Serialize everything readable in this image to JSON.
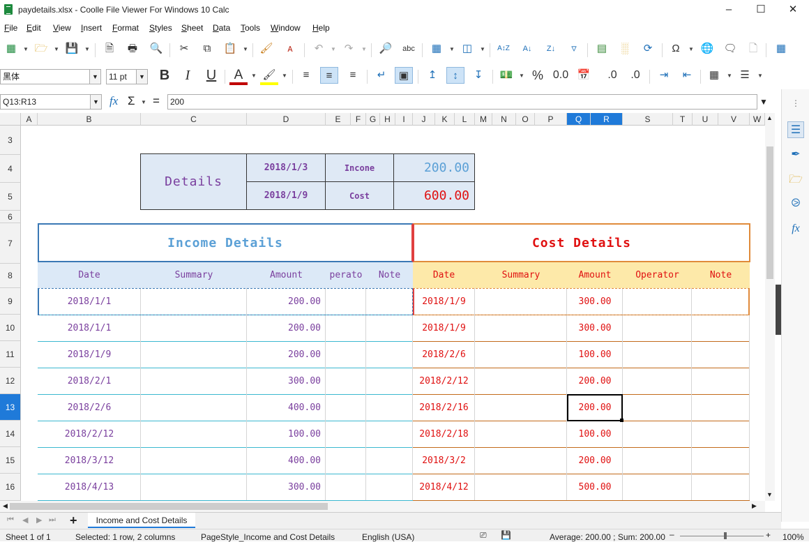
{
  "window": {
    "title": "paydetails.xlsx - Coolle File Viewer For Windows 10 Calc"
  },
  "menu": [
    "File",
    "Edit",
    "View",
    "Insert",
    "Format",
    "Styles",
    "Sheet",
    "Data",
    "Tools",
    "Window",
    "Help"
  ],
  "format_bar": {
    "font_name": "黑体",
    "font_size": "11 pt"
  },
  "formula_bar": {
    "name_box": "Q13:R13",
    "fx": "fx",
    "sigma": "Σ",
    "equals": "=",
    "value": "200"
  },
  "columns": [
    "A",
    "B",
    "C",
    "D",
    "E",
    "F",
    "G",
    "H",
    "I",
    "J",
    "K",
    "L",
    "M",
    "N",
    "O",
    "P",
    "Q",
    "R",
    "S",
    "T",
    "U",
    "V",
    "W"
  ],
  "rows": [
    "3",
    "4",
    "5",
    "6",
    "7",
    "8",
    "9",
    "10",
    "11",
    "12",
    "13",
    "14",
    "15",
    "16"
  ],
  "summary": {
    "label": "Details",
    "date1": "2018/1/3",
    "type1": "Incone",
    "value1": "200.00",
    "date2": "2018/1/9",
    "type2": "Cost",
    "value2": "600.00"
  },
  "income": {
    "title": "Income Details",
    "headers": [
      "Date",
      "Summary",
      "Amount",
      "Operator",
      "Note"
    ],
    "header_operator_display": "perato",
    "rows": [
      {
        "date": "2018/1/1",
        "amount": "200.00"
      },
      {
        "date": "2018/1/1",
        "amount": "200.00"
      },
      {
        "date": "2018/1/9",
        "amount": "200.00"
      },
      {
        "date": "2018/2/1",
        "amount": "300.00"
      },
      {
        "date": "2018/2/6",
        "amount": "400.00"
      },
      {
        "date": "2018/2/12",
        "amount": "100.00"
      },
      {
        "date": "2018/3/12",
        "amount": "400.00"
      },
      {
        "date": "2018/4/13",
        "amount": "300.00"
      }
    ]
  },
  "cost": {
    "title": "Cost Details",
    "headers": [
      "Date",
      "Summary",
      "Amount",
      "Operator",
      "Note"
    ],
    "rows": [
      {
        "date": "2018/1/9",
        "amount": "300.00"
      },
      {
        "date": "2018/1/9",
        "amount": "300.00"
      },
      {
        "date": "2018/2/6",
        "amount": "100.00"
      },
      {
        "date": "2018/2/12",
        "amount": "200.00"
      },
      {
        "date": "2018/2/16",
        "amount": "200.00"
      },
      {
        "date": "2018/2/18",
        "amount": "100.00"
      },
      {
        "date": "2018/3/2",
        "amount": "200.00"
      },
      {
        "date": "2018/4/12",
        "amount": "500.00"
      }
    ]
  },
  "sheet_tab": "Income and Cost Details",
  "status": {
    "sheet": "Sheet 1 of 1",
    "selection": "Selected: 1 row, 2 columns",
    "page_style": "PageStyle_Income and Cost Details",
    "language": "English (USA)",
    "stats": "Average: 200.00 ; Sum: 200.00",
    "zoom": "100%"
  },
  "colors": {
    "accent": "#1f7ad9",
    "income_border": "#3a78b5",
    "cost_border": "#e08a3a",
    "cost_text": "#e01010",
    "income_text": "#7a3f9e",
    "cost_header_bg": "#fde9a9",
    "income_header_bg": "#dce9f7"
  }
}
